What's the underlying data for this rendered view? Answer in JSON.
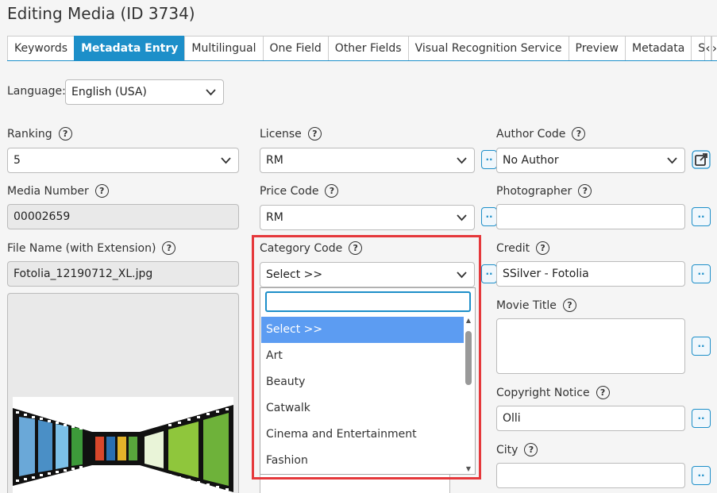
{
  "page": {
    "title": "Editing Media (ID 3734)"
  },
  "tabs": [
    {
      "label": "Keywords"
    },
    {
      "label": "Metadata Entry",
      "active": true
    },
    {
      "label": "Multilingual"
    },
    {
      "label": "One Field"
    },
    {
      "label": "Other Fields"
    },
    {
      "label": "Visual Recognition Service"
    },
    {
      "label": "Preview"
    },
    {
      "label": "Metadata"
    },
    {
      "label": "Statistic"
    }
  ],
  "tab_nav": {
    "prev": "‹",
    "next": "›"
  },
  "language": {
    "label": "Language:",
    "value": "English (USA)"
  },
  "ranking": {
    "label": "Ranking",
    "value": "5"
  },
  "license": {
    "label": "License",
    "value": "RM"
  },
  "author_code": {
    "label": "Author Code",
    "value": "No Author"
  },
  "media_number": {
    "label": "Media Number",
    "value": "00002659"
  },
  "price_code": {
    "label": "Price Code",
    "value": "RM"
  },
  "photographer": {
    "label": "Photographer",
    "value": ""
  },
  "file_name": {
    "label": "File Name (with Extension)",
    "value": "Fotolia_12190712_XL.jpg"
  },
  "category_code": {
    "label": "Category Code",
    "value": "Select >>",
    "search_value": "",
    "options": [
      "Select >>",
      "Art",
      "Beauty",
      "Catwalk",
      "Cinema and Entertainment",
      "Fashion"
    ],
    "selected_index": 0
  },
  "credit": {
    "label": "Credit",
    "value": "SSilver - Fotolia"
  },
  "movie_title": {
    "label": "Movie Title",
    "value": ""
  },
  "copyright_notice": {
    "label": "Copyright Notice",
    "value": "Olli"
  },
  "city": {
    "label": "City",
    "value": ""
  },
  "ui": {
    "help_glyph": "?",
    "more_glyph": "..",
    "accent": "#1d8fc9",
    "highlight": "#e5383b",
    "selected_bg": "#5c9cf2"
  }
}
